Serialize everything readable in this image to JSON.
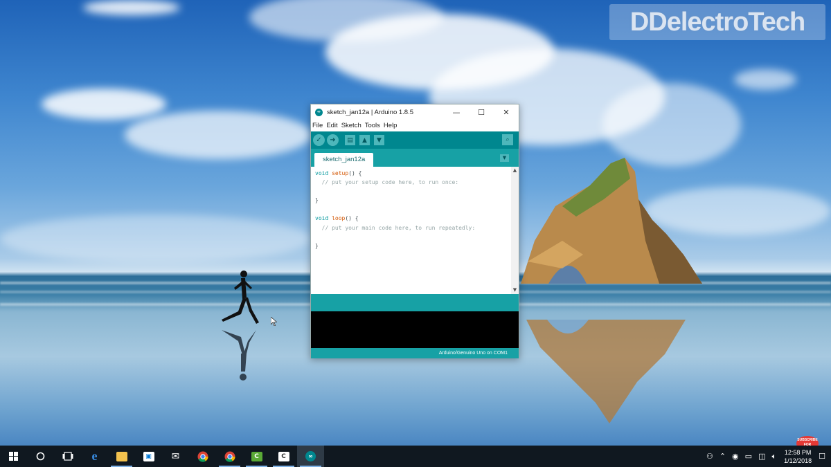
{
  "watermark": {
    "text": "DDelectroTech"
  },
  "window": {
    "title": "sketch_jan12a | Arduino 1.8.5",
    "controls": {
      "minimize": "—",
      "maximize": "☐",
      "close": "✕"
    },
    "menu": [
      "File",
      "Edit",
      "Sketch",
      "Tools",
      "Help"
    ],
    "toolbar": {
      "verify_icon": "check-icon",
      "upload_icon": "arrow-right-icon",
      "new_icon": "new-file-icon",
      "open_icon": "open-icon",
      "save_icon": "save-icon",
      "serial_icon": "magnifier-icon"
    },
    "tab": {
      "label": "sketch_jan12a"
    },
    "code": {
      "line1_kw": "void",
      "line1_fn": "setup",
      "line1_rest": "() {",
      "line2": "  // put your setup code here, to run once:",
      "line3": "",
      "line4": "}",
      "line5": "",
      "line6_kw": "void",
      "line6_fn": "loop",
      "line6_rest": "() {",
      "line7": "  // put your main code here, to run repeatedly:",
      "line8": "",
      "line9": "}"
    },
    "status": "Arduino/Genuino Uno on COM1"
  },
  "taskbar": {
    "start_icon": "windows-icon",
    "search_icon": "cortana-circle-icon",
    "task_view_icon": "task-view-icon",
    "pinned": [
      "edge-icon",
      "file-explorer-icon",
      "store-icon",
      "mail-icon",
      "chrome-icon",
      "chrome-icon",
      "camtasia-icon",
      "camtasia-recorder-icon",
      "arduino-icon"
    ],
    "clock": {
      "time": "12:58 PM",
      "date": "1/12/2018"
    }
  },
  "subscribe": {
    "text": "SUBSCRIBE FOR UPDATES"
  },
  "colors": {
    "arduino_dark": "#00878f",
    "arduino_mid": "#17a1a5",
    "taskbar": "#101820"
  }
}
